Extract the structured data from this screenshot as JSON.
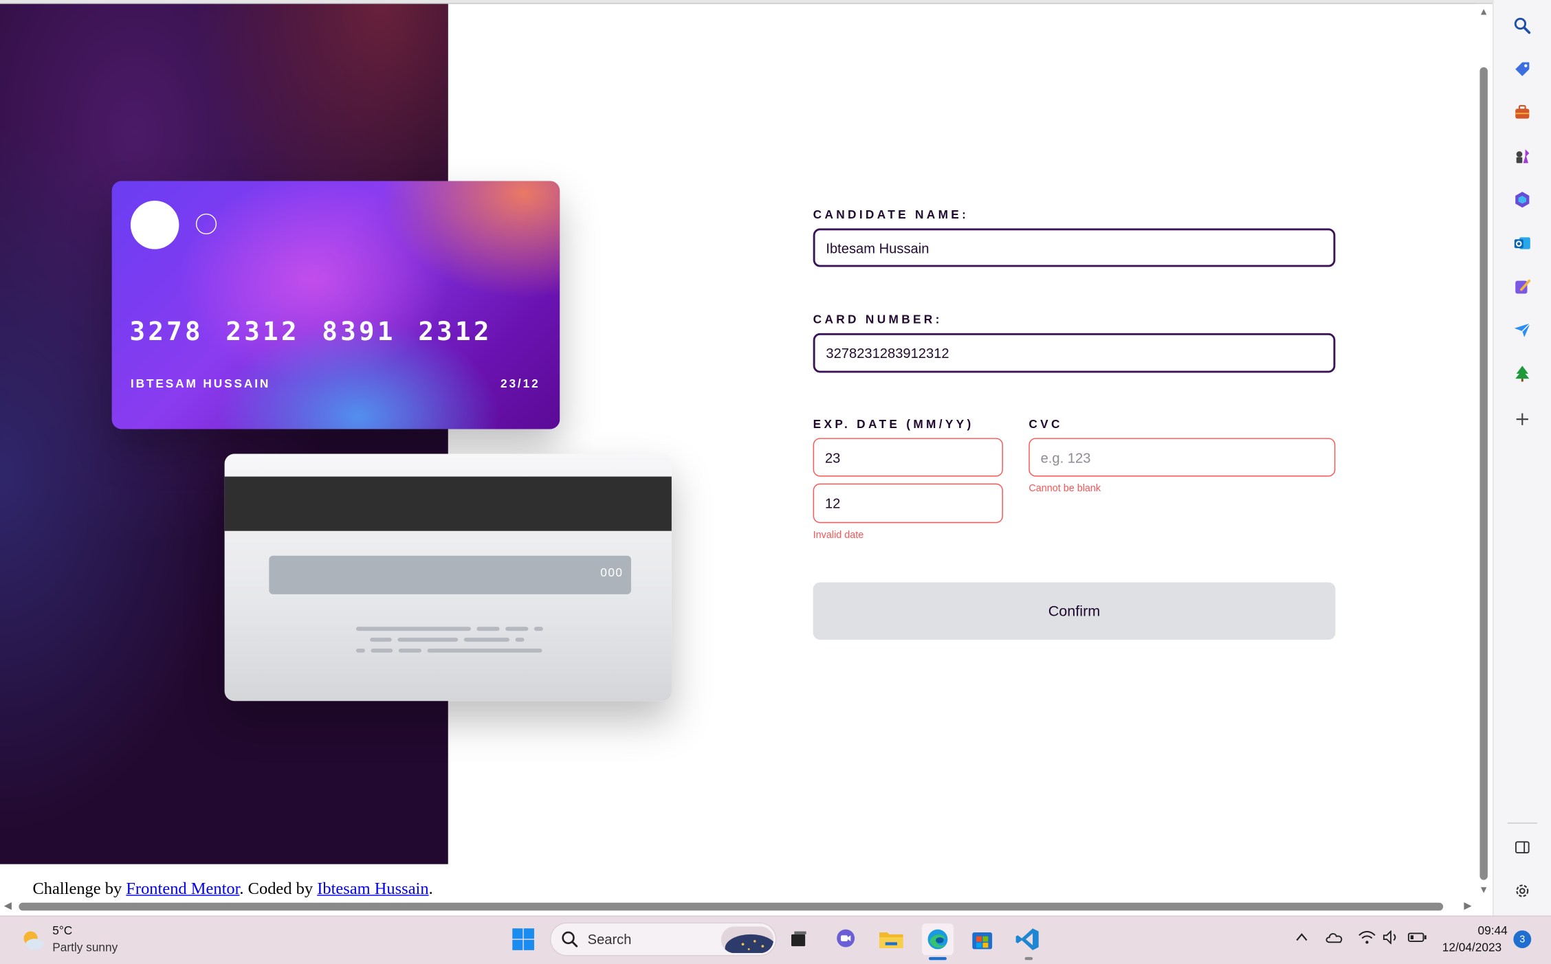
{
  "card_preview": {
    "number": "3278  2312  8391  2312",
    "holder": "IBTESAM HUSSAIN",
    "expiry": "23/12",
    "cvc": "000"
  },
  "form": {
    "name_label": "CANDIDATE NAME:",
    "name_value": "Ibtesam Hussain",
    "number_label": "CARD NUMBER:",
    "number_value": "3278231283912312",
    "exp_label": "EXP. DATE (MM/YY)",
    "exp_month_value": "23",
    "exp_year_value": "12",
    "exp_error": "Invalid date",
    "cvc_label": "CVC",
    "cvc_placeholder": "e.g. 123",
    "cvc_error": "Cannot be blank",
    "confirm_label": "Confirm"
  },
  "footer": {
    "prefix": "Challenge by ",
    "link1": "Frontend Mentor",
    "middle": ". Coded by ",
    "link2": "Ibtesam Hussain",
    "suffix": "."
  },
  "sidebar_icons": [
    "search-icon",
    "tag-icon",
    "briefcase-icon",
    "chess-icon",
    "office-icon",
    "outlook-icon",
    "designer-icon",
    "send-icon",
    "tree-icon",
    "add-icon",
    "split-screen-icon",
    "settings-icon"
  ],
  "taskbar": {
    "weather_temp": "5°C",
    "weather_desc": "Partly sunny",
    "search_label": "Search",
    "time": "09:44",
    "date": "12/04/2023",
    "notifications": "3"
  },
  "colors": {
    "accent_dark": "#21092f",
    "error": "#ff5252",
    "link": "#0000ee"
  }
}
